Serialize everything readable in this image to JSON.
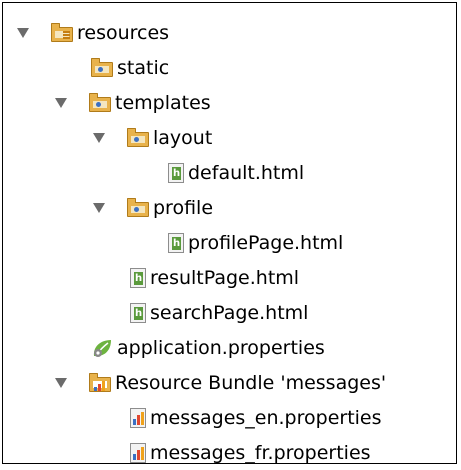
{
  "tree": {
    "resources": {
      "label": "resources",
      "icon": "resources-folder-icon"
    },
    "static": {
      "label": "static",
      "icon": "folder-icon"
    },
    "templates": {
      "label": "templates",
      "icon": "folder-icon"
    },
    "layout": {
      "label": "layout",
      "icon": "folder-icon"
    },
    "default_html": {
      "label": "default.html",
      "icon": "html-file-icon"
    },
    "profile": {
      "label": "profile",
      "icon": "folder-icon"
    },
    "profilePage_html": {
      "label": "profilePage.html",
      "icon": "html-file-icon"
    },
    "resultPage_html": {
      "label": "resultPage.html",
      "icon": "html-file-icon"
    },
    "searchPage_html": {
      "label": "searchPage.html",
      "icon": "html-file-icon"
    },
    "application_properties": {
      "label": "application.properties",
      "icon": "spring-leaf-icon"
    },
    "resource_bundle": {
      "label": "Resource Bundle 'messages'",
      "icon": "resource-bundle-icon"
    },
    "messages_en": {
      "label": "messages_en.properties",
      "icon": "properties-file-icon"
    },
    "messages_fr": {
      "label": "messages_fr.properties",
      "icon": "properties-file-icon"
    }
  },
  "colors": {
    "arrow": "#6b6b6b",
    "folder": "#e8b24b",
    "html_badge": "#5a9a3c",
    "spring_green": "#6db33f"
  }
}
